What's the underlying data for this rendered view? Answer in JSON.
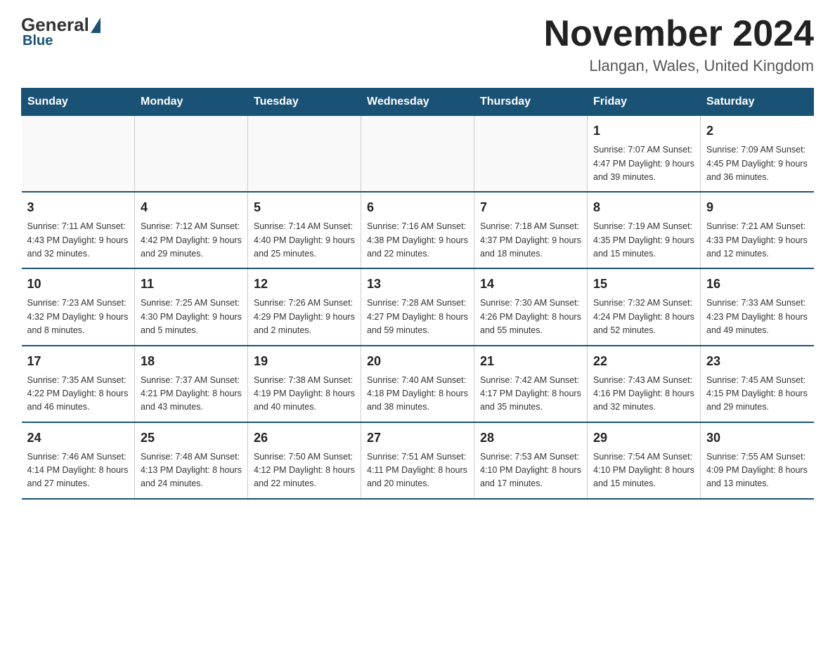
{
  "header": {
    "logo_general": "General",
    "logo_blue": "Blue",
    "month_title": "November 2024",
    "location": "Llangan, Wales, United Kingdom"
  },
  "weekdays": [
    "Sunday",
    "Monday",
    "Tuesday",
    "Wednesday",
    "Thursday",
    "Friday",
    "Saturday"
  ],
  "weeks": [
    [
      {
        "day": "",
        "info": ""
      },
      {
        "day": "",
        "info": ""
      },
      {
        "day": "",
        "info": ""
      },
      {
        "day": "",
        "info": ""
      },
      {
        "day": "",
        "info": ""
      },
      {
        "day": "1",
        "info": "Sunrise: 7:07 AM\nSunset: 4:47 PM\nDaylight: 9 hours\nand 39 minutes."
      },
      {
        "day": "2",
        "info": "Sunrise: 7:09 AM\nSunset: 4:45 PM\nDaylight: 9 hours\nand 36 minutes."
      }
    ],
    [
      {
        "day": "3",
        "info": "Sunrise: 7:11 AM\nSunset: 4:43 PM\nDaylight: 9 hours\nand 32 minutes."
      },
      {
        "day": "4",
        "info": "Sunrise: 7:12 AM\nSunset: 4:42 PM\nDaylight: 9 hours\nand 29 minutes."
      },
      {
        "day": "5",
        "info": "Sunrise: 7:14 AM\nSunset: 4:40 PM\nDaylight: 9 hours\nand 25 minutes."
      },
      {
        "day": "6",
        "info": "Sunrise: 7:16 AM\nSunset: 4:38 PM\nDaylight: 9 hours\nand 22 minutes."
      },
      {
        "day": "7",
        "info": "Sunrise: 7:18 AM\nSunset: 4:37 PM\nDaylight: 9 hours\nand 18 minutes."
      },
      {
        "day": "8",
        "info": "Sunrise: 7:19 AM\nSunset: 4:35 PM\nDaylight: 9 hours\nand 15 minutes."
      },
      {
        "day": "9",
        "info": "Sunrise: 7:21 AM\nSunset: 4:33 PM\nDaylight: 9 hours\nand 12 minutes."
      }
    ],
    [
      {
        "day": "10",
        "info": "Sunrise: 7:23 AM\nSunset: 4:32 PM\nDaylight: 9 hours\nand 8 minutes."
      },
      {
        "day": "11",
        "info": "Sunrise: 7:25 AM\nSunset: 4:30 PM\nDaylight: 9 hours\nand 5 minutes."
      },
      {
        "day": "12",
        "info": "Sunrise: 7:26 AM\nSunset: 4:29 PM\nDaylight: 9 hours\nand 2 minutes."
      },
      {
        "day": "13",
        "info": "Sunrise: 7:28 AM\nSunset: 4:27 PM\nDaylight: 8 hours\nand 59 minutes."
      },
      {
        "day": "14",
        "info": "Sunrise: 7:30 AM\nSunset: 4:26 PM\nDaylight: 8 hours\nand 55 minutes."
      },
      {
        "day": "15",
        "info": "Sunrise: 7:32 AM\nSunset: 4:24 PM\nDaylight: 8 hours\nand 52 minutes."
      },
      {
        "day": "16",
        "info": "Sunrise: 7:33 AM\nSunset: 4:23 PM\nDaylight: 8 hours\nand 49 minutes."
      }
    ],
    [
      {
        "day": "17",
        "info": "Sunrise: 7:35 AM\nSunset: 4:22 PM\nDaylight: 8 hours\nand 46 minutes."
      },
      {
        "day": "18",
        "info": "Sunrise: 7:37 AM\nSunset: 4:21 PM\nDaylight: 8 hours\nand 43 minutes."
      },
      {
        "day": "19",
        "info": "Sunrise: 7:38 AM\nSunset: 4:19 PM\nDaylight: 8 hours\nand 40 minutes."
      },
      {
        "day": "20",
        "info": "Sunrise: 7:40 AM\nSunset: 4:18 PM\nDaylight: 8 hours\nand 38 minutes."
      },
      {
        "day": "21",
        "info": "Sunrise: 7:42 AM\nSunset: 4:17 PM\nDaylight: 8 hours\nand 35 minutes."
      },
      {
        "day": "22",
        "info": "Sunrise: 7:43 AM\nSunset: 4:16 PM\nDaylight: 8 hours\nand 32 minutes."
      },
      {
        "day": "23",
        "info": "Sunrise: 7:45 AM\nSunset: 4:15 PM\nDaylight: 8 hours\nand 29 minutes."
      }
    ],
    [
      {
        "day": "24",
        "info": "Sunrise: 7:46 AM\nSunset: 4:14 PM\nDaylight: 8 hours\nand 27 minutes."
      },
      {
        "day": "25",
        "info": "Sunrise: 7:48 AM\nSunset: 4:13 PM\nDaylight: 8 hours\nand 24 minutes."
      },
      {
        "day": "26",
        "info": "Sunrise: 7:50 AM\nSunset: 4:12 PM\nDaylight: 8 hours\nand 22 minutes."
      },
      {
        "day": "27",
        "info": "Sunrise: 7:51 AM\nSunset: 4:11 PM\nDaylight: 8 hours\nand 20 minutes."
      },
      {
        "day": "28",
        "info": "Sunrise: 7:53 AM\nSunset: 4:10 PM\nDaylight: 8 hours\nand 17 minutes."
      },
      {
        "day": "29",
        "info": "Sunrise: 7:54 AM\nSunset: 4:10 PM\nDaylight: 8 hours\nand 15 minutes."
      },
      {
        "day": "30",
        "info": "Sunrise: 7:55 AM\nSunset: 4:09 PM\nDaylight: 8 hours\nand 13 minutes."
      }
    ]
  ]
}
